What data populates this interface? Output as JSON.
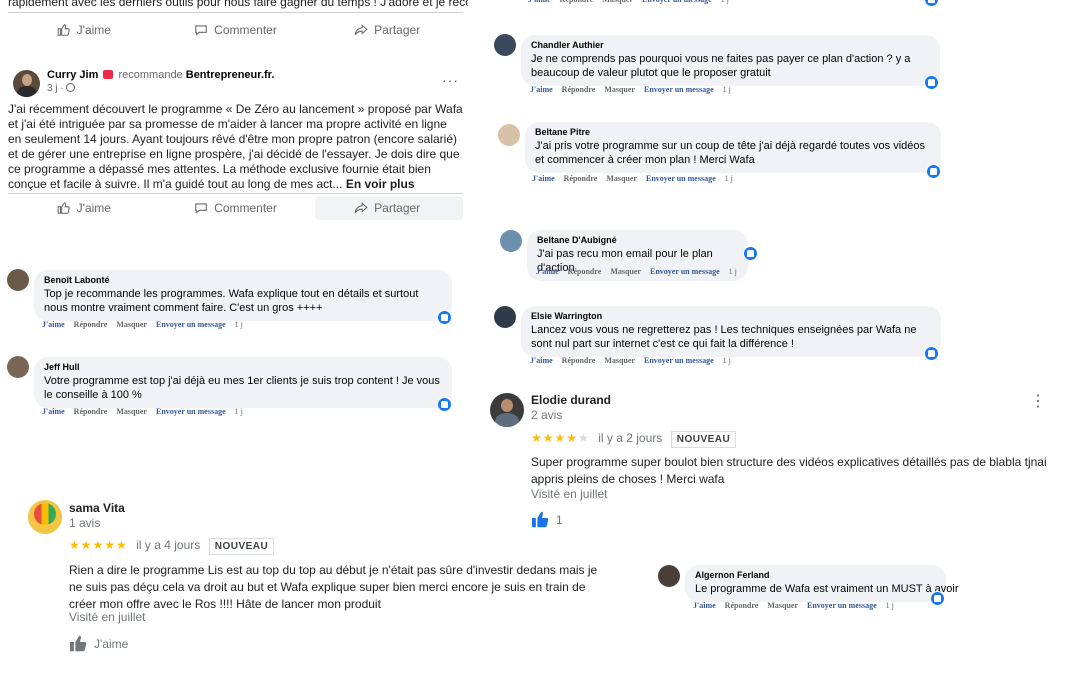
{
  "post_top": {
    "cut_text": "rapidement avec les derniers outils pour nous faire gagner du temps ! J'adore et je recommande !",
    "like": "J'aime",
    "comment": "Commenter",
    "share": "Partager"
  },
  "post_curry": {
    "author": "Curry Jim",
    "recommends": "recommande",
    "page": "Bentrepreneur.fr.",
    "time": "3 j ·",
    "body": "J'ai récemment découvert le programme « De Zéro au lancement » proposé par Wafa et j'ai été intriguée par sa promesse de m'aider à lancer ma propre activité en ligne en seulement 14 jours. Ayant toujours rêvé d'être mon propre patron (encore salarié) et de gérer une entreprise en ligne prospère, j'ai décidé de l'essayer. Je dois dire que ce programme a dépassé mes attentes. La méthode exclusive fournie était bien conçue et facile à suivre. Il m'a guidé tout au long de mes act...",
    "see_more": "En voir plus",
    "like": "J'aime",
    "comment": "Commenter",
    "share": "Partager"
  },
  "comment_actions": {
    "like": "J'aime",
    "reply": "Répondre",
    "hide": "Masquer",
    "message": "Envoyer un message",
    "time": "1 j"
  },
  "comments": {
    "benoit": {
      "name": "Benoît Labonté",
      "text": "Top je recommande les programmes. Wafa explique tout en détails et surtout nous montre vraiment comment faire. C'est un gros ++++"
    },
    "jeff": {
      "name": "Jeff Hull",
      "text": "Votre programme est top j'ai déjà eu mes 1er clients je suis trop content ! Je vous le conseille à 100 %"
    },
    "chandler": {
      "name": "Chandler Authier",
      "text": "Je ne comprends pas pourquoi vous ne faites pas payer ce plan d'action ? y a beaucoup de valeur plutot que le proposer gratuit"
    },
    "beltane_p": {
      "name": "Beltane Pitre",
      "text": "J'ai pris votre programme sur un coup de tête j'ai déjà regardé toutes vos vidéos et commencer à créer mon plan ! Merci Wafa"
    },
    "beltane_d": {
      "name": "Beltane D'Aubigné",
      "text": "J'ai pas recu mon email pour le plan d'action"
    },
    "elsie": {
      "name": "Elsie Warrington",
      "text": "Lancez vous vous ne regretterez pas ! Les techniques enseignées par Wafa ne sont nul part sur internet c'est ce qui fait la différence !"
    },
    "algernon": {
      "name": "Algernon Ferland",
      "text": "Le programme de Wafa est vraiment un MUST à avoir"
    }
  },
  "review_elodie": {
    "name": "Elodie durand",
    "count": "2 avis",
    "stars": "★★★★",
    "empty_star": "★",
    "when": "il y a 2 jours",
    "badge": "NOUVEAU",
    "text": "Super programme super boulot bien structure des vidéos explicatives détaillés pas de blabla tjnai appris pleins de choses ! Merci wafa",
    "visited": "Visité en juillet",
    "likes": "1"
  },
  "review_sama": {
    "name": "sama Vita",
    "count": "1 avis",
    "stars": "★★★★★",
    "when": "il y a 4 jours",
    "badge": "NOUVEAU",
    "text": "Rien a dire le programme Lis est au top du top au début je n'était pas sûre d'investir dedans mais je ne suis pas déçu cela va droit au but et Wafa explique super bien merci encore je suis en train de créer mon offre avec le Ros !!!! Hâte de lancer mon produit",
    "visited": "Visité en juillet",
    "like": "J'aime"
  },
  "colors": {
    "fb_blue": "#1877f2",
    "link_blue": "#385898",
    "star": "#fbbc04"
  }
}
